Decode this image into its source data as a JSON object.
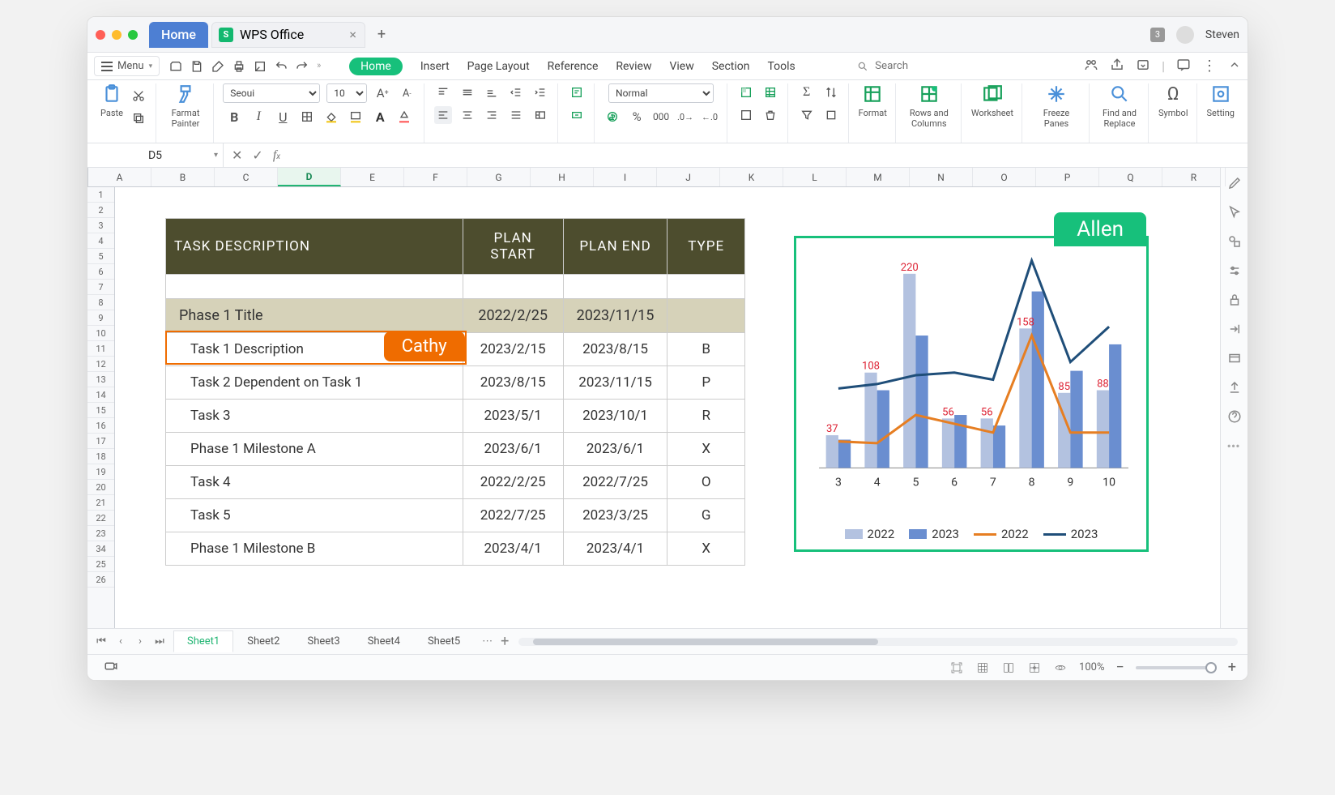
{
  "window": {
    "home_tab": "Home",
    "doc_tab": "WPS Office",
    "notif_count": "3",
    "user": "Steven"
  },
  "menubar": {
    "menu_label": "Menu",
    "items": [
      "Home",
      "Insert",
      "Page Layout",
      "Reference",
      "Review",
      "View",
      "Section",
      "Tools"
    ],
    "search_placeholder": "Search"
  },
  "ribbon": {
    "paste": "Paste",
    "format_painter": "Farmat Painter",
    "font_name": "Seoui",
    "font_size": "10",
    "cell_style": "Normal",
    "format": "Format",
    "rows_cols": "Rows and Columns",
    "worksheet": "Worksheet",
    "freeze": "Freeze Panes",
    "find_replace": "Find and Replace",
    "symbol": "Symbol",
    "setting": "Setting"
  },
  "fxbar": {
    "cell_ref": "D5",
    "formula": ""
  },
  "grid": {
    "cols": [
      "A",
      "B",
      "C",
      "D",
      "E",
      "F",
      "G",
      "H",
      "I",
      "J",
      "K",
      "L",
      "M",
      "N",
      "O",
      "P",
      "Q",
      "R"
    ],
    "rows": [
      "1",
      "2",
      "3",
      "4",
      "5",
      "6",
      "7",
      "8",
      "9",
      "10",
      "11",
      "12",
      "13",
      "14",
      "15",
      "16",
      "17",
      "18",
      "19",
      "20",
      "21",
      "22",
      "23",
      "34",
      "25",
      "26"
    ],
    "sel_col": "D"
  },
  "table": {
    "headers": {
      "desc": "TASK DESCRIPTION",
      "start": "PLAN START",
      "end": "PLAN END",
      "type": "TYPE"
    },
    "phase": {
      "desc": "Phase 1 Title",
      "start": "2022/2/25",
      "end": "2023/11/15",
      "type": ""
    },
    "rows": [
      {
        "desc": "Task 1 Description",
        "start": "2023/2/15",
        "end": "2023/8/15",
        "type": "B"
      },
      {
        "desc": "Task 2 Dependent on Task 1",
        "start": "2023/8/15",
        "end": "2023/11/15",
        "type": "P"
      },
      {
        "desc": "Task 3",
        "start": "2023/5/1",
        "end": "2023/10/1",
        "type": "R"
      },
      {
        "desc": "Phase 1 Milestone A",
        "start": "2023/6/1",
        "end": "2023/6/1",
        "type": "X"
      },
      {
        "desc": "Task 4",
        "start": "2022/2/25",
        "end": "2022/7/25",
        "type": "O"
      },
      {
        "desc": "Task 5",
        "start": "2022/7/25",
        "end": "2023/3/25",
        "type": "G"
      },
      {
        "desc": "Phase 1 Milestone B",
        "start": "2023/4/1",
        "end": "2023/4/1",
        "type": "X"
      }
    ],
    "cathy_tag": "Cathy",
    "allen_tag": "Allen"
  },
  "chart_data": {
    "type": "bar+line",
    "categories": [
      "3",
      "4",
      "5",
      "6",
      "7",
      "8",
      "9",
      "10"
    ],
    "series": [
      {
        "name": "2022",
        "kind": "bar",
        "color": "#b3c2e0",
        "values": [
          37,
          108,
          220,
          56,
          56,
          158,
          85,
          88
        ]
      },
      {
        "name": "2023",
        "kind": "bar",
        "color": "#6a8ed0",
        "values": [
          32,
          88,
          150,
          60,
          48,
          200,
          110,
          140
        ]
      },
      {
        "name": "2022",
        "kind": "line",
        "color": "#e67e22",
        "values": [
          30,
          28,
          60,
          50,
          40,
          150,
          40,
          40
        ]
      },
      {
        "name": "2023",
        "kind": "line",
        "color": "#1f4e79",
        "values": [
          90,
          95,
          105,
          108,
          100,
          235,
          120,
          160
        ]
      }
    ],
    "labels": [
      37,
      108,
      220,
      56,
      56,
      158,
      85,
      88
    ],
    "ylim": [
      0,
      240
    ],
    "legend": [
      "2022",
      "2023",
      "2022",
      "2023"
    ]
  },
  "sheets": {
    "tabs": [
      "Sheet1",
      "Sheet2",
      "Sheet3",
      "Sheet4",
      "Sheet5"
    ],
    "active": "Sheet1"
  },
  "statusbar": {
    "zoom": "100%"
  }
}
